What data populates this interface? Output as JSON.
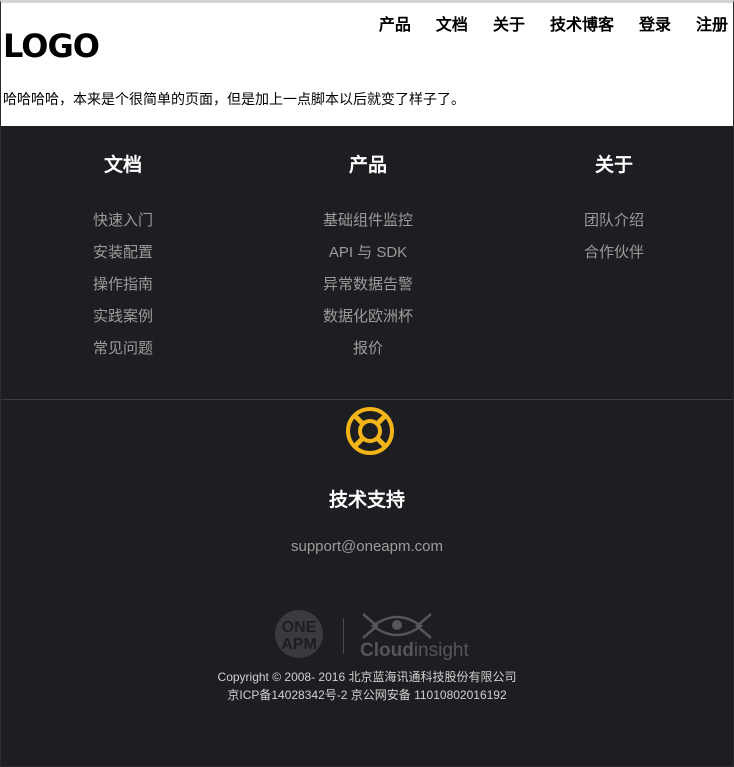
{
  "nav": {
    "items": [
      {
        "label": "产品"
      },
      {
        "label": "文档"
      },
      {
        "label": "关于"
      },
      {
        "label": "技术博客"
      },
      {
        "label": "登录"
      },
      {
        "label": "注册"
      }
    ]
  },
  "header": {
    "logo": "LOGO",
    "intro": "哈哈哈哈，本来是个很简单的页面，但是加上一点脚本以后就变了样子了。"
  },
  "footer": {
    "columns": [
      {
        "title": "文档",
        "links": [
          "快速入门",
          "安装配置",
          "操作指南",
          "实践案例",
          "常见问题"
        ]
      },
      {
        "title": "产品",
        "links": [
          "基础组件监控",
          "API 与 SDK",
          "异常数据告警",
          "数据化欧洲杯",
          "报价"
        ]
      },
      {
        "title": "关于",
        "links": [
          "团队介绍",
          "合作伙伴"
        ]
      }
    ],
    "support": {
      "icon": "lifebuoy-icon",
      "title": "技术支持",
      "email": "support@oneapm.com"
    },
    "brands": {
      "oneapm_line1": "ONE",
      "oneapm_line2": "APM",
      "cloudinsight_part1": "Cloud",
      "cloudinsight_part2": "insight"
    },
    "copyright_line1": "Copyright © 2008- 2016 北京蓝海讯通科技股份有限公司",
    "copyright_line2": "京ICP备14028342号-2 京公网安备 11010802016192"
  },
  "colors": {
    "footer_bg": "#1d1e21",
    "accent_yellow": "#f2b418",
    "link_gray": "#9b9b9b"
  }
}
